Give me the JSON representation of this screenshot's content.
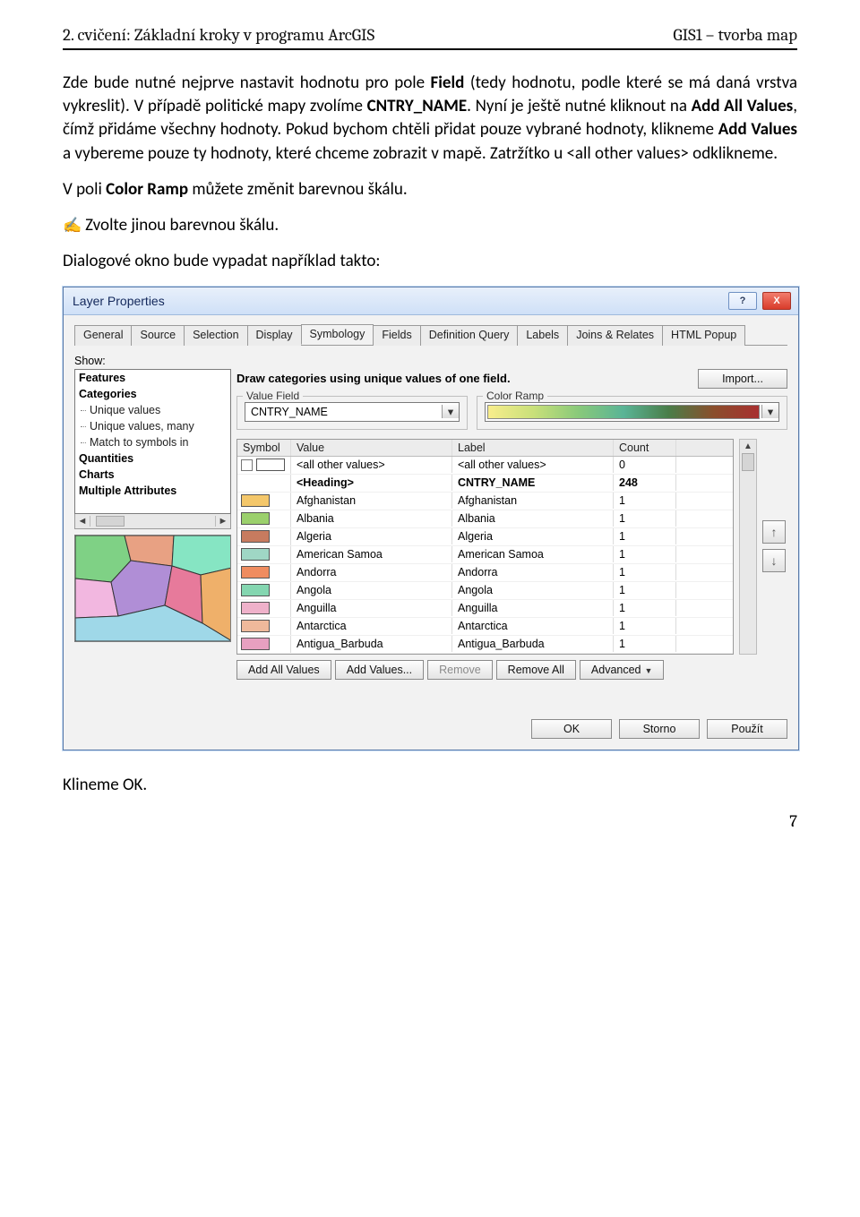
{
  "header": {
    "left": "2. cvičení: Základní kroky v programu ArcGIS",
    "right": "GIS1 – tvorba map"
  },
  "paragraphs": {
    "p1a": "Zde bude nutné nejprve nastavit hodnotu pro pole ",
    "p1b": "Field",
    "p1c": " (tedy hodnotu, podle které se má daná vrstva vykreslit). V případě politické mapy zvolíme ",
    "p1d": "CNTRY_NAME",
    "p1e": ".  Nyní je ještě nutné kliknout na ",
    "p1f": "Add All Values",
    "p1g": ", čímž přidáme všechny hodnoty. Pokud bychom chtěli přidat pouze vybrané hodnoty, klikneme ",
    "p1h": "Add Values",
    "p1i": " a vybereme pouze ty hodnoty, které chceme zobrazit v mapě. Zatržítko u <all other values> odklikneme.",
    "p2a": "V poli ",
    "p2b": "Color Ramp",
    "p2c": " můžete změnit barevnou škálu.",
    "p3": "Zvolte jinou barevnou škálu.",
    "p4": "Dialogové okno bude vypadat například takto:",
    "p5": "Klineme OK."
  },
  "dialog": {
    "title": "Layer Properties",
    "help": "?",
    "close": "X",
    "tabs": {
      "t0": "General",
      "t1": "Source",
      "t2": "Selection",
      "t3": "Display",
      "t4": "Symbology",
      "t5": "Fields",
      "t6": "Definition Query",
      "t7": "Labels",
      "t8": "Joins & Relates",
      "t9": "HTML Popup"
    },
    "show_label": "Show:",
    "show_list": {
      "i0": "Features",
      "i1": "Categories",
      "i2": "Unique values",
      "i3": "Unique values, many",
      "i4": "Match to symbols in",
      "i5": "Quantities",
      "i6": "Charts",
      "i7": "Multiple Attributes"
    },
    "desc": "Draw categories using unique values of one field.",
    "import": "Import...",
    "value_field_label": "Value Field",
    "value_field": "CNTRY_NAME",
    "color_ramp_label": "Color Ramp",
    "grid_head": {
      "c0": "Symbol",
      "c1": "Value",
      "c2": "Label",
      "c3": "Count"
    },
    "grid_scroll_up": "▲",
    "rows": [
      {
        "swatch": "#fff",
        "val": "<all other values>",
        "label": "<all other values>",
        "count": "0",
        "checkbox": true
      },
      {
        "swatch": "",
        "val": "<Heading>",
        "label": "CNTRY_NAME",
        "count": "248",
        "bold": true
      },
      {
        "swatch": "#f4c76a",
        "val": "Afghanistan",
        "label": "Afghanistan",
        "count": "1"
      },
      {
        "swatch": "#9bd06c",
        "val": "Albania",
        "label": "Albania",
        "count": "1"
      },
      {
        "swatch": "#c77b5f",
        "val": "Algeria",
        "label": "Algeria",
        "count": "1"
      },
      {
        "swatch": "#9fd7c5",
        "val": "American Samoa",
        "label": "American Samoa",
        "count": "1"
      },
      {
        "swatch": "#ef8c60",
        "val": "Andorra",
        "label": "Andorra",
        "count": "1"
      },
      {
        "swatch": "#84d6b0",
        "val": "Angola",
        "label": "Angola",
        "count": "1"
      },
      {
        "swatch": "#efb1ca",
        "val": "Anguilla",
        "label": "Anguilla",
        "count": "1"
      },
      {
        "swatch": "#efb99b",
        "val": "Antarctica",
        "label": "Antarctica",
        "count": "1"
      },
      {
        "swatch": "#e7a0c0",
        "val": "Antigua_Barbuda",
        "label": "Antigua_Barbuda",
        "count": "1"
      }
    ],
    "btns": {
      "addall": "Add All Values",
      "addvals": "Add Values...",
      "remove": "Remove",
      "removeall": "Remove All",
      "advanced": "Advanced"
    },
    "up": "↑",
    "down": "↓",
    "ok": "OK",
    "cancel": "Storno",
    "apply": "Použít"
  },
  "page_num": "7"
}
